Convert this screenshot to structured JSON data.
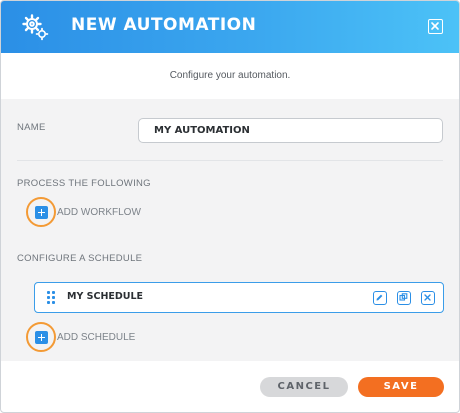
{
  "dialog": {
    "title": "NEW AUTOMATION",
    "header_icon": "gears-icon",
    "close_icon": "close-icon",
    "subtitle": "Configure your automation."
  },
  "form": {
    "name_label": "NAME",
    "name_value": "MY AUTOMATION",
    "process_label": "PROCESS THE FOLLOWING",
    "add_workflow_label": "ADD WORKFLOW",
    "schedule_label": "CONFIGURE A SCHEDULE",
    "schedules": [
      {
        "name": "MY SCHEDULE",
        "actions": [
          "edit-icon",
          "duplicate-icon",
          "delete-icon"
        ]
      }
    ],
    "add_schedule_label": "ADD SCHEDULE"
  },
  "footer": {
    "cancel_label": "CANCEL",
    "save_label": "SAVE"
  },
  "colors": {
    "header_start": "#2b8fe6",
    "header_end": "#4cc2f7",
    "accent": "#2b8fe6",
    "highlight": "#f39a35",
    "save": "#f36f21",
    "cancel": "#d7d8da"
  }
}
